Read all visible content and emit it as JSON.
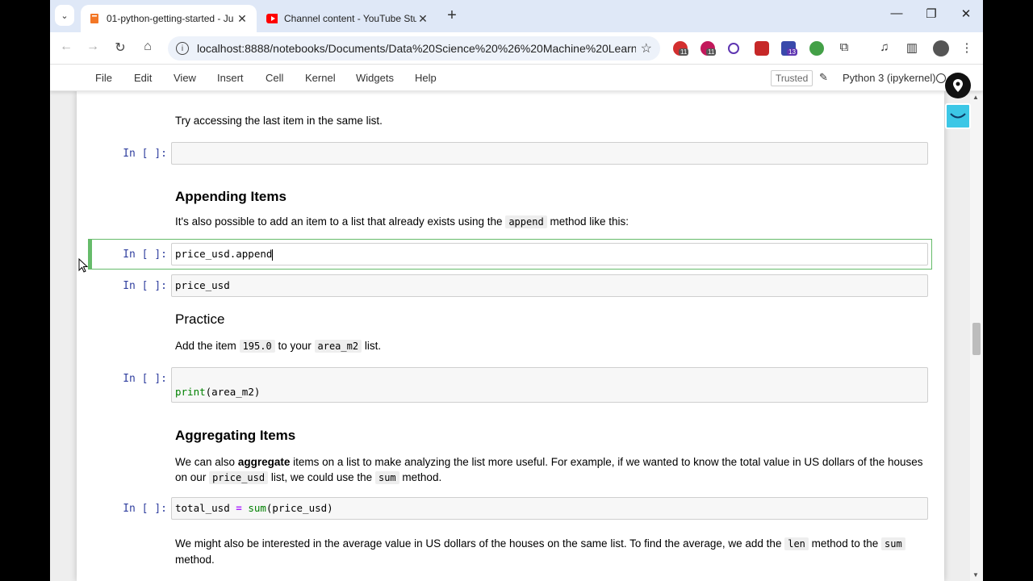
{
  "browser": {
    "tabs": [
      {
        "title": "01-python-getting-started - Ju",
        "active": true
      },
      {
        "title": "Channel content - YouTube Stu",
        "active": false
      }
    ],
    "url": "localhost:8888/notebooks/Documents/Data%20Science%20%26%20Machine%20Learning(...",
    "ext_badges": [
      "11",
      "11",
      "13"
    ]
  },
  "jupyter": {
    "menu": [
      "File",
      "Edit",
      "View",
      "Insert",
      "Cell",
      "Kernel",
      "Widgets",
      "Help"
    ],
    "trusted": "Trusted",
    "kernel": "Python 3 (ipykernel)"
  },
  "cells": {
    "p_last": "Try accessing the last item in the same list.",
    "prompt": "In [ ]:",
    "h_append": "Appending Items",
    "p_append_1": "It's also possible to add an item to a list that already exists using the",
    "p_append_code": "append",
    "p_append_2": "method like this:",
    "c_append": "price_usd.append",
    "c_price": "price_usd",
    "h_practice": "Practice",
    "p_practice_1": "Add the item",
    "p_practice_code1": "195.0",
    "p_practice_2": "to your",
    "p_practice_code2": "area_m2",
    "p_practice_3": "list.",
    "c_print_fn": "print",
    "c_print_args": "(area_m2)",
    "h_agg": "Aggregating Items",
    "p_agg_1": "We can also",
    "p_agg_bold": "aggregate",
    "p_agg_2": "items on a list to make analyzing the list more useful. For example, if we wanted to know the total value in US dollars of the houses on",
    "p_agg_3": "our",
    "p_agg_code1": "price_usd",
    "p_agg_4": "list, we could use the",
    "p_agg_code2": "sum",
    "p_agg_5": "method.",
    "c_total_a": "total_usd",
    "c_total_op": "=",
    "c_total_fn": "sum",
    "c_total_args": "(price_usd)",
    "p_avg_1": "We might also be interested in the average value in US dollars of the houses on the same list. To find the average, we add the",
    "p_avg_code1": "len",
    "p_avg_2": "method to the",
    "p_avg_code2": "sum",
    "p_avg_3": "method."
  }
}
